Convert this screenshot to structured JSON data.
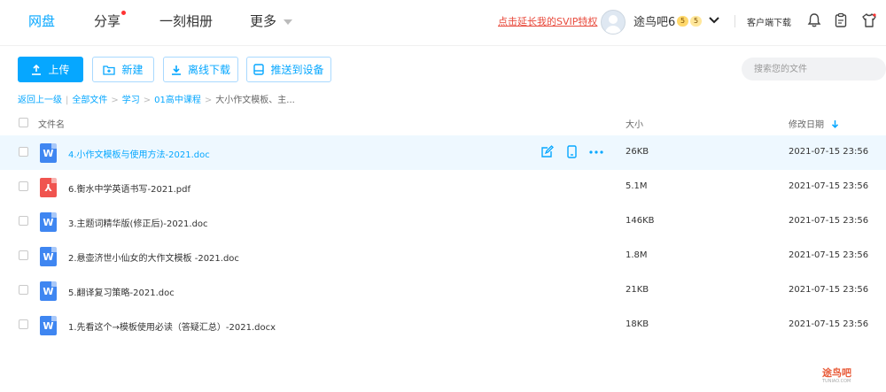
{
  "nav": {
    "items": [
      {
        "label": "网盘",
        "active": true
      },
      {
        "label": "分享",
        "has_dot": true
      },
      {
        "label": "一刻相册"
      },
      {
        "label": "更多"
      }
    ]
  },
  "header": {
    "svip_link": "点击延长我的SVIP特权",
    "username": "途鸟吧6",
    "badge_1": "5",
    "badge_2": "5",
    "client_download": "客户端下载"
  },
  "toolbar": {
    "upload": "上传",
    "new": "新建",
    "offline_download": "离线下载",
    "push_to_device": "推送到设备",
    "search_placeholder": "搜索您的文件"
  },
  "breadcrumb": {
    "back": "返回上一级",
    "all_files": "全部文件",
    "level1": "学习",
    "level2": "01高中课程",
    "current": "大小作文模板、主..."
  },
  "table": {
    "col_name": "文件名",
    "col_size": "大小",
    "col_modified": "修改日期",
    "rows": [
      {
        "name": "4.小作文模板与使用方法-2021.doc",
        "size": "26KB",
        "modified": "2021-07-15 23:56",
        "type": "doc",
        "highlighted": true
      },
      {
        "name": "6.衡水中学英语书写-2021.pdf",
        "size": "5.1M",
        "modified": "2021-07-15 23:56",
        "type": "pdf"
      },
      {
        "name": "3.主题词精华版(修正后)-2021.doc",
        "size": "146KB",
        "modified": "2021-07-15 23:56",
        "type": "doc"
      },
      {
        "name": "2.悬壶济世小仙女的大作文模板 -2021.doc",
        "size": "1.8M",
        "modified": "2021-07-15 23:56",
        "type": "doc"
      },
      {
        "name": "5.翻译复习策略-2021.doc",
        "size": "21KB",
        "modified": "2021-07-15 23:56",
        "type": "doc"
      },
      {
        "name": "1.先看这个→模板使用必读（答疑汇总）-2021.docx",
        "size": "18KB",
        "modified": "2021-07-15 23:56",
        "type": "doc"
      }
    ]
  },
  "icons": {
    "doc_letter": "W",
    "pdf_letter": "⅄"
  },
  "watermark": {
    "main": "途鸟吧",
    "sub": "TUNIAO.COM"
  },
  "colors": {
    "accent": "#06a7ff",
    "svip": "#e84a3c",
    "doc": "#3f86f1",
    "pdf": "#f0544f",
    "highlight_row": "#eef8ff"
  }
}
